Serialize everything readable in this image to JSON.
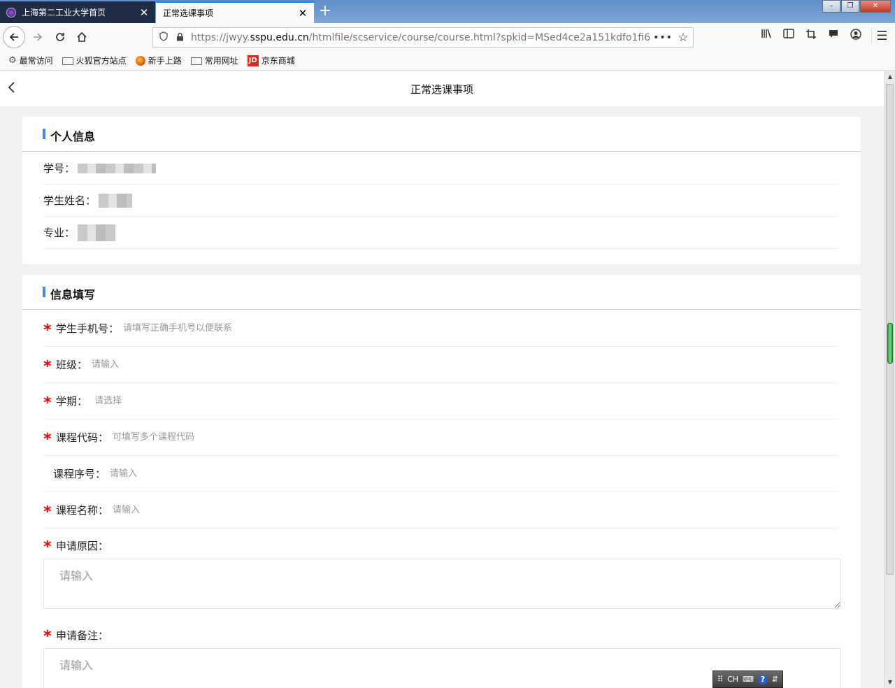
{
  "browser": {
    "tabs": [
      {
        "label": "上海第二工业大学首页",
        "active": false
      },
      {
        "label": "正常选课事项",
        "active": true
      }
    ],
    "close_glyph": "✕",
    "new_tab_glyph": "+",
    "url_prefix": "https://jwyy.",
    "url_host": "sspu.edu.cn",
    "url_path": "/htmlfile/scservice/course/course.html?spkid=MSed4ce2a151kdfo1fi6",
    "url_more": "•••",
    "bookmarks": [
      {
        "label": "最常访问",
        "icon": "gear-icon"
      },
      {
        "label": "火狐官方站点",
        "icon": "folder-icon"
      },
      {
        "label": "新手上路",
        "icon": "firefox-icon"
      },
      {
        "label": "常用网址",
        "icon": "folder-icon"
      },
      {
        "label": "京东商城",
        "icon": "jd-icon"
      }
    ],
    "jd_badge": "JD",
    "ime": {
      "lang": "CH"
    }
  },
  "page": {
    "title": "正常选课事项",
    "back_glyph": "‹"
  },
  "personal_info": {
    "heading": "个人信息",
    "fields": [
      {
        "label": "学号："
      },
      {
        "label": "学生姓名："
      },
      {
        "label": "专业："
      }
    ]
  },
  "form": {
    "heading": "信息填写",
    "required_mark": "*",
    "fields": [
      {
        "label": "学生手机号：",
        "placeholder": "请填写正确手机号以便联系",
        "required": true
      },
      {
        "label": "班级：",
        "placeholder": "请输入",
        "required": true
      },
      {
        "label": "学期：",
        "placeholder": "请选择",
        "required": true
      },
      {
        "label": "课程代码：",
        "placeholder": "可填写多个课程代码",
        "required": true
      },
      {
        "label": "课程序号：",
        "placeholder": "请输入",
        "required": false
      },
      {
        "label": "课程名称：",
        "placeholder": "请输入",
        "required": true
      }
    ],
    "textareas": [
      {
        "label": "申请原因：",
        "placeholder": "请输入",
        "required": true
      },
      {
        "label": "申请备注：",
        "placeholder": "请输入",
        "required": true
      }
    ]
  },
  "colors": {
    "accent": "#4a87e8",
    "required": "#ee0000",
    "tab_active_border": "#0a84ff"
  }
}
